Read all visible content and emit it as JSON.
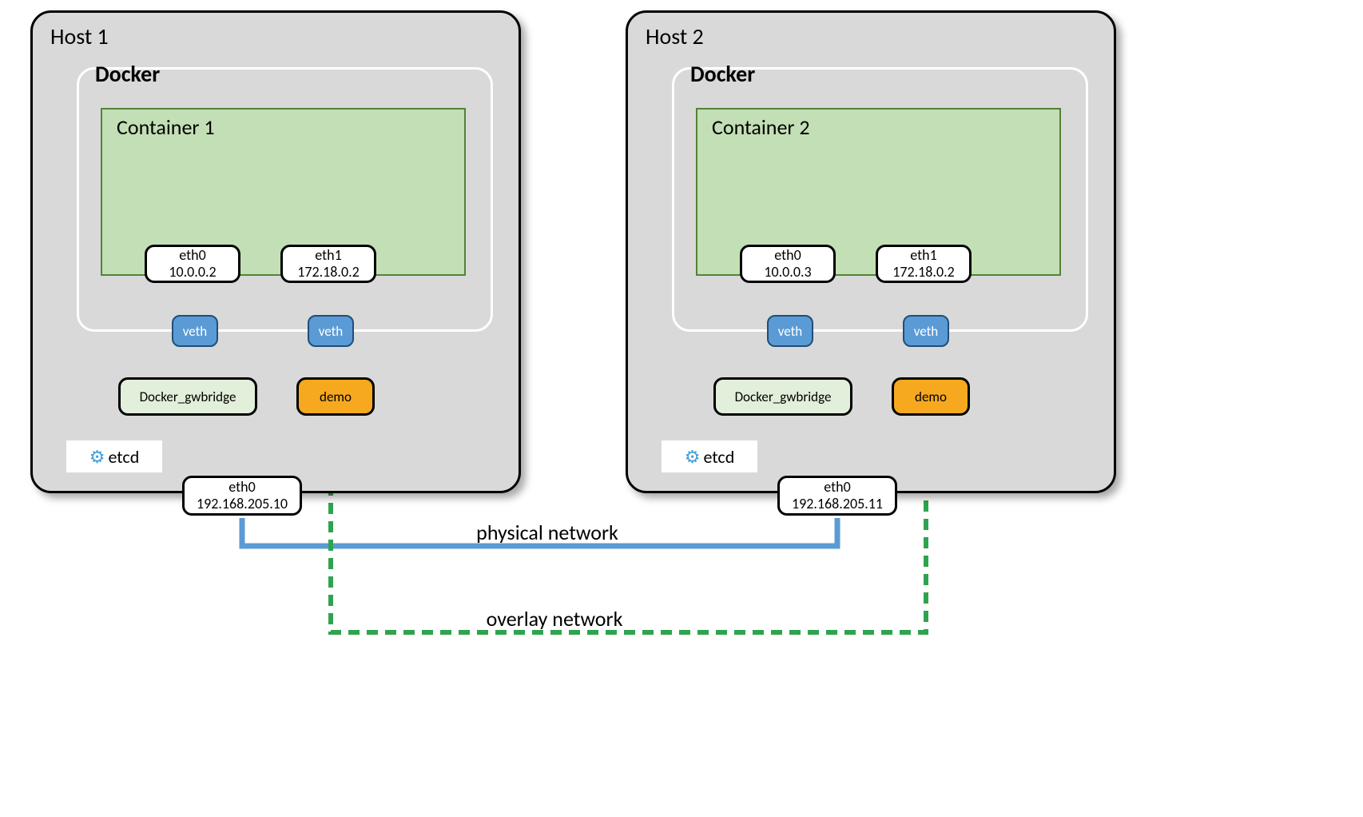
{
  "hosts": [
    {
      "name": "Host 1",
      "docker_label": "Docker",
      "container_label": "Container 1",
      "eth0": {
        "name": "eth0",
        "ip": "10.0.0.2"
      },
      "eth1": {
        "name": "eth1",
        "ip": "172.18.0.2"
      },
      "veth_label": "veth",
      "gwbridge_label": "Docker_gwbridge",
      "demo_label": "demo",
      "etcd_label": "etcd",
      "host_eth0": {
        "name": "eth0",
        "ip": "192.168.205.10"
      }
    },
    {
      "name": "Host 2",
      "docker_label": "Docker",
      "container_label": "Container 2",
      "eth0": {
        "name": "eth0",
        "ip": "10.0.0.3"
      },
      "eth1": {
        "name": "eth1",
        "ip": "172.18.0.2"
      },
      "veth_label": "veth",
      "gwbridge_label": "Docker_gwbridge",
      "demo_label": "demo",
      "etcd_label": "etcd",
      "host_eth0": {
        "name": "eth0",
        "ip": "192.168.205.11"
      }
    }
  ],
  "physical_network_label": "physical network",
  "overlay_network_label": "overlay network"
}
